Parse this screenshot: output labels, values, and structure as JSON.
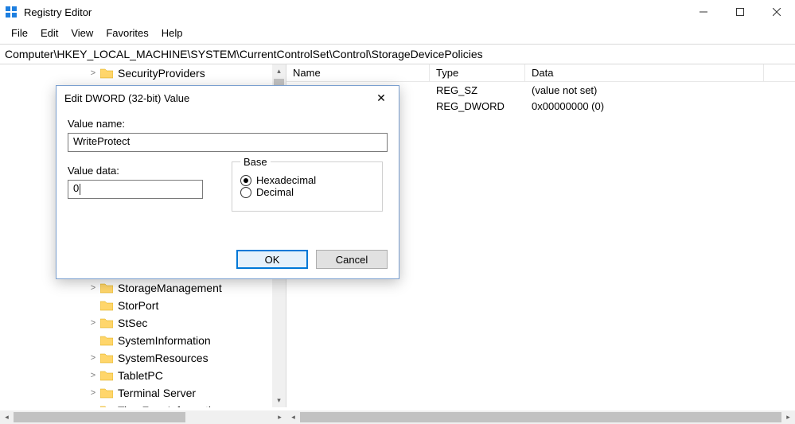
{
  "window": {
    "title": "Registry Editor"
  },
  "menu": [
    "File",
    "Edit",
    "View",
    "Favorites",
    "Help"
  ],
  "address": "Computer\\HKEY_LOCAL_MACHINE\\SYSTEM\\CurrentControlSet\\Control\\StorageDevicePolicies",
  "tree": [
    {
      "label": "SecurityProviders",
      "exp": ">",
      "indent": "indent0"
    },
    {
      "label": "StorageManagement",
      "exp": ">",
      "indent": "indent0"
    },
    {
      "label": "StorPort",
      "exp": "",
      "indent": "indent0"
    },
    {
      "label": "StSec",
      "exp": ">",
      "indent": "indent0"
    },
    {
      "label": "SystemInformation",
      "exp": "",
      "indent": "indent0"
    },
    {
      "label": "SystemResources",
      "exp": ">",
      "indent": "indent0"
    },
    {
      "label": "TabletPC",
      "exp": ">",
      "indent": "indent0"
    },
    {
      "label": "Terminal Server",
      "exp": ">",
      "indent": "indent0"
    },
    {
      "label": "TimeZoneInformation",
      "exp": "",
      "indent": "indent0"
    }
  ],
  "list": {
    "columns": {
      "name": "Name",
      "type": "Type",
      "data": "Data"
    },
    "rows": [
      {
        "name": "",
        "type": "REG_SZ",
        "data": "(value not set)"
      },
      {
        "name": "",
        "type": "REG_DWORD",
        "data": "0x00000000 (0)"
      }
    ]
  },
  "dialog": {
    "title": "Edit DWORD (32-bit) Value",
    "labels": {
      "value_name": "Value name:",
      "value_data": "Value data:",
      "base": "Base"
    },
    "value_name": "WriteProtect",
    "value_data": "0",
    "radios": {
      "hex": "Hexadecimal",
      "dec": "Decimal"
    },
    "buttons": {
      "ok": "OK",
      "cancel": "Cancel"
    }
  }
}
